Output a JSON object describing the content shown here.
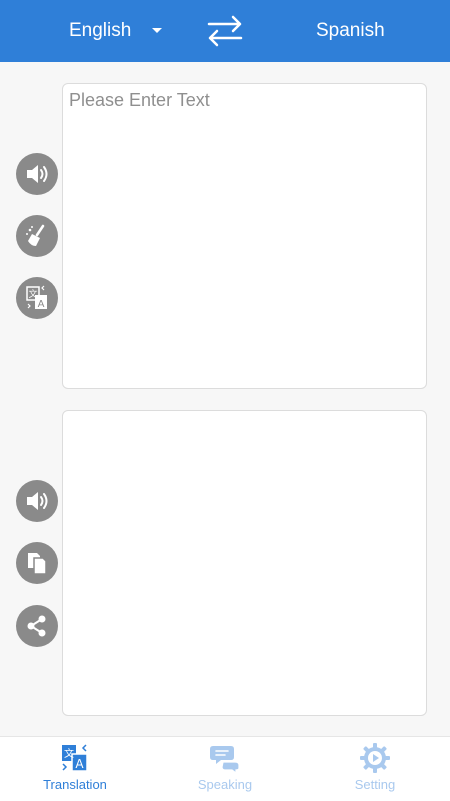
{
  "header": {
    "source_language": "English",
    "target_language": "Spanish",
    "swap_icon": "swap-arrows-icon"
  },
  "input_panel": {
    "placeholder": "Please Enter Text",
    "value": ""
  },
  "output_panel": {
    "value": ""
  },
  "side_actions": {
    "input": [
      "speaker-icon",
      "clear-broom-icon",
      "translate-icon"
    ],
    "output": [
      "speaker-icon",
      "copy-icon",
      "share-icon"
    ]
  },
  "bottom_nav": {
    "tabs": [
      {
        "label": "Translation",
        "icon": "translate-icon",
        "active": true
      },
      {
        "label": "Speaking",
        "icon": "chat-bubbles-icon",
        "active": false
      },
      {
        "label": "Setting",
        "icon": "gear-icon",
        "active": false
      }
    ]
  },
  "colors": {
    "primary": "#2f7fd8",
    "inactive_tab": "#a9c9ee",
    "action_button": "#8a8a8a",
    "background": "#f7f7f7"
  }
}
